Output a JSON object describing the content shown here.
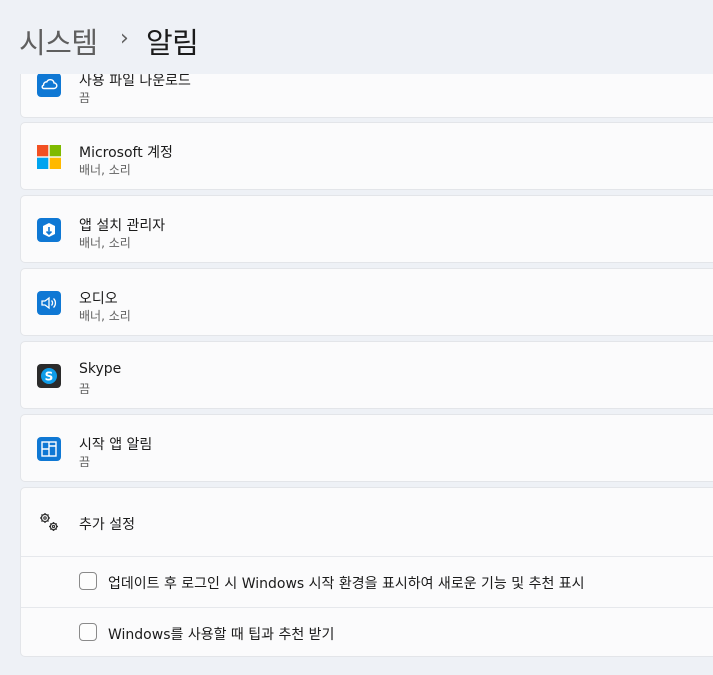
{
  "breadcrumb": {
    "parent": "시스템",
    "separator": "›",
    "current": "알림"
  },
  "apps": [
    {
      "title": "사용 파일 나운로드",
      "subtitle": "끔",
      "icon": "onedrive-cloud-icon"
    },
    {
      "title": "Microsoft 계정",
      "subtitle": "배너, 소리",
      "icon": "microsoft-logo-icon"
    },
    {
      "title": "앱 설치 관리자",
      "subtitle": "배너, 소리",
      "icon": "app-installer-icon"
    },
    {
      "title": "오디오",
      "subtitle": "배너, 소리",
      "icon": "speaker-icon"
    },
    {
      "title": "Skype",
      "subtitle": "끔",
      "icon": "skype-icon"
    },
    {
      "title": "시작 앱 알림",
      "subtitle": "끔",
      "icon": "startup-apps-icon"
    }
  ],
  "additional": {
    "title": "추가 설정",
    "icon": "gears-icon",
    "options": [
      {
        "label": "업데이트 후 로그인 시 Windows 시작 환경을 표시하여 새로운 기능 및 추천 표시",
        "checked": false
      },
      {
        "label": "Windows를 사용할 때 팁과 추천 받기",
        "checked": false
      }
    ]
  },
  "colors": {
    "accent": "#0067c0",
    "background": "#eef1f6",
    "card": "#fbfbfc"
  }
}
